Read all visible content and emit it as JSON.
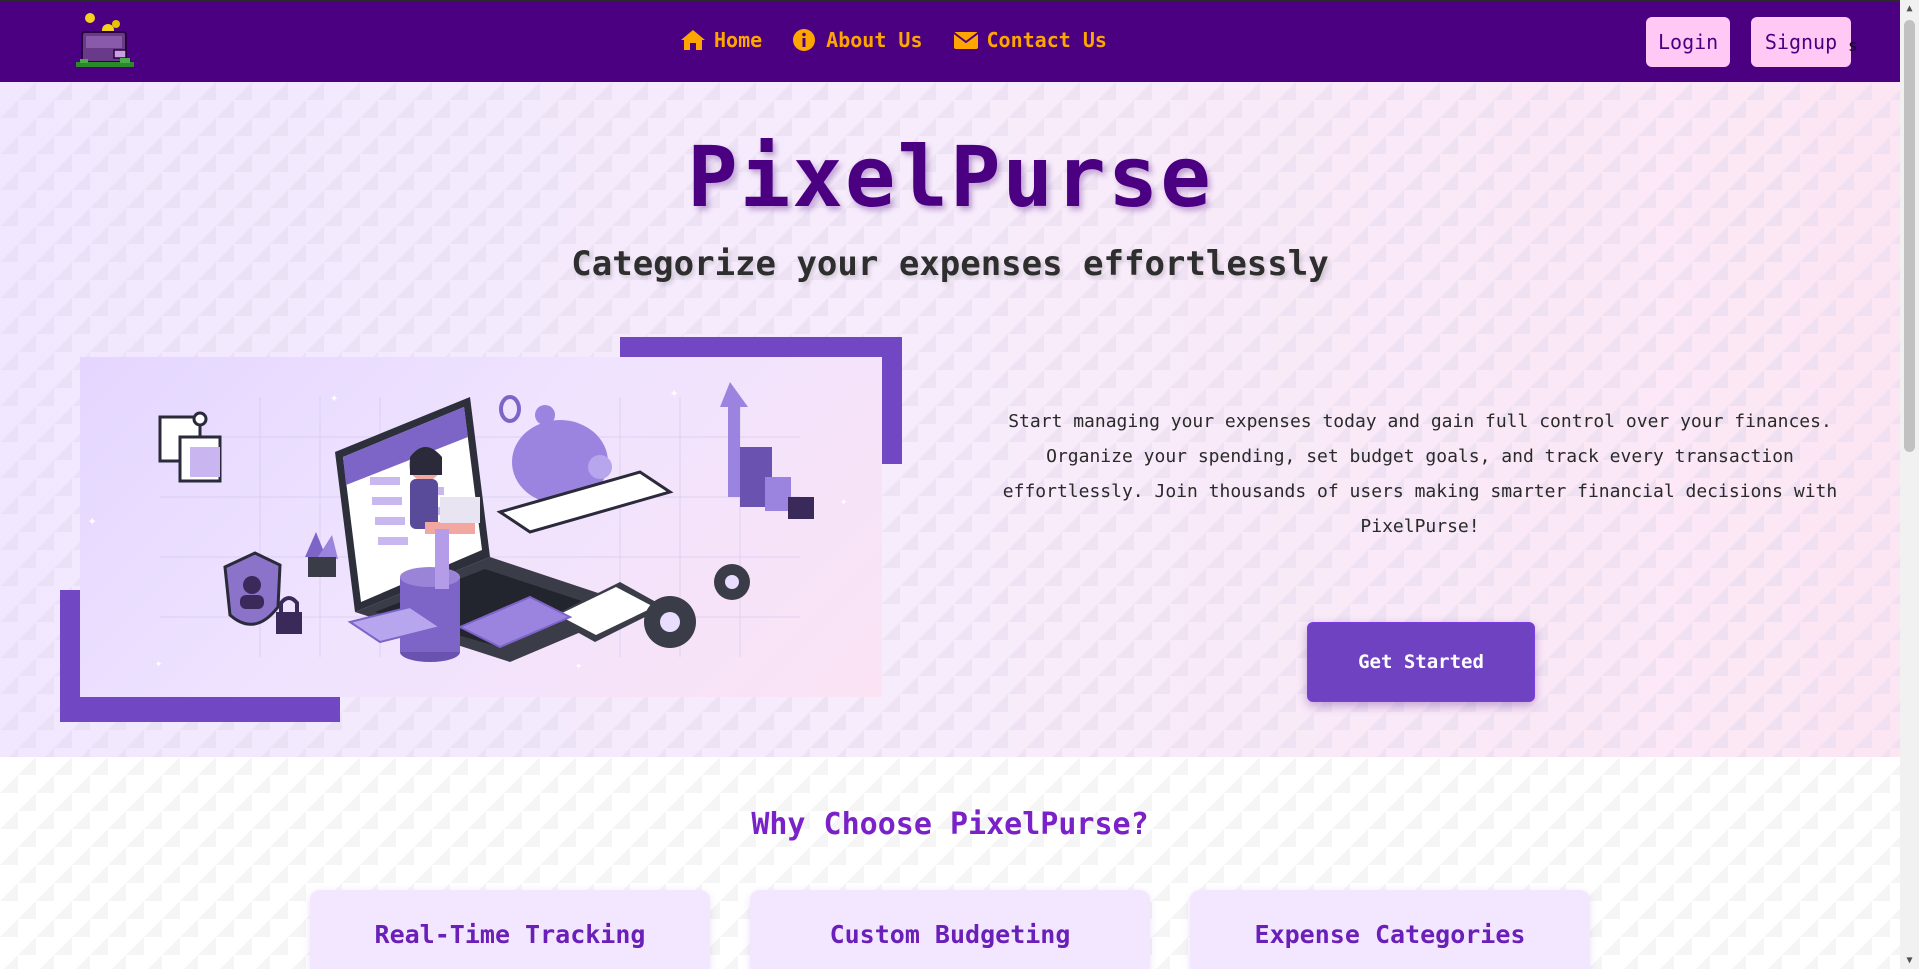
{
  "nav": {
    "links": [
      {
        "label": "Home",
        "icon": "home-icon"
      },
      {
        "label": "About Us",
        "icon": "info-icon"
      },
      {
        "label": "Contact Us",
        "icon": "envelope-icon"
      }
    ],
    "login_label": "Login",
    "signup_label": "Signup",
    "stray_text": "s"
  },
  "hero": {
    "title": "PixelPurse",
    "tagline": "Categorize your expenses effortlessly",
    "description": "Start managing your expenses today and gain full control over your finances. Organize your spending, set budget goals, and track every transaction effortlessly. Join thousands of users making smarter financial decisions with PixelPurse!",
    "cta_label": "Get Started"
  },
  "features": {
    "title": "Why Choose PixelPurse?",
    "cards": [
      {
        "title": "Real-Time Tracking"
      },
      {
        "title": "Custom Budgeting"
      },
      {
        "title": "Expense Categories"
      }
    ]
  },
  "colors": {
    "nav_bg": "#4b0082",
    "nav_link": "#ffa500",
    "auth_btn_bg": "#ffc8f5",
    "accent": "#6f42c1",
    "title": "#4b0082"
  }
}
